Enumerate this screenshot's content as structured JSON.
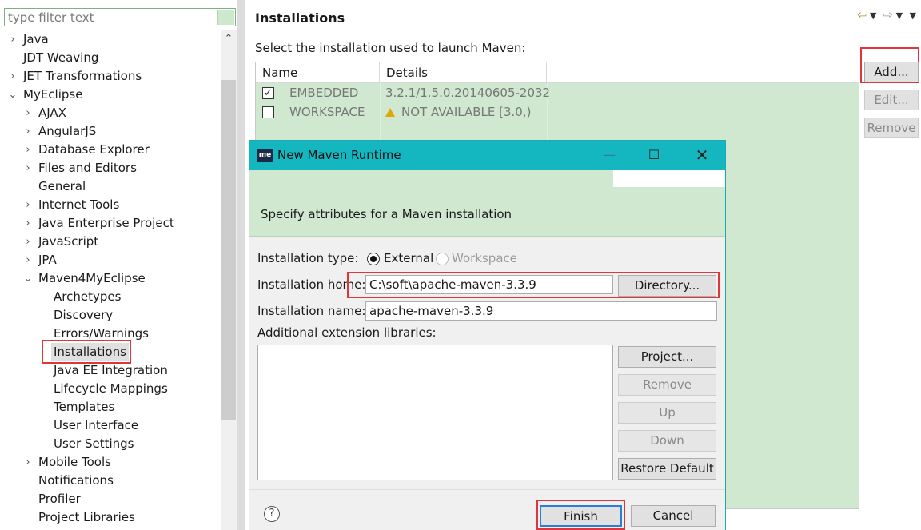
{
  "filter": {
    "placeholder": "type filter text"
  },
  "tree": [
    {
      "label": "Java",
      "chevron": "›"
    },
    {
      "label": "JDT Weaving",
      "chevron": ""
    },
    {
      "label": "JET Transformations",
      "chevron": "›"
    },
    {
      "label": "MyEclipse",
      "chevron": "⌄"
    },
    {
      "label": "AJAX",
      "chevron": "›"
    },
    {
      "label": "AngularJS",
      "chevron": "›"
    },
    {
      "label": "Database Explorer",
      "chevron": "›"
    },
    {
      "label": "Files and Editors",
      "chevron": "›"
    },
    {
      "label": "General",
      "chevron": ""
    },
    {
      "label": "Internet Tools",
      "chevron": "›"
    },
    {
      "label": "Java Enterprise Project",
      "chevron": "›"
    },
    {
      "label": "JavaScript",
      "chevron": "›"
    },
    {
      "label": "JPA",
      "chevron": "›"
    },
    {
      "label": "Maven4MyEclipse",
      "chevron": "⌄"
    },
    {
      "label": "Archetypes",
      "chevron": ""
    },
    {
      "label": "Discovery",
      "chevron": ""
    },
    {
      "label": "Errors/Warnings",
      "chevron": ""
    },
    {
      "label": "Installations",
      "chevron": ""
    },
    {
      "label": "Java EE Integration",
      "chevron": ""
    },
    {
      "label": "Lifecycle Mappings",
      "chevron": ""
    },
    {
      "label": "Templates",
      "chevron": ""
    },
    {
      "label": "User Interface",
      "chevron": ""
    },
    {
      "label": "User Settings",
      "chevron": ""
    },
    {
      "label": "Mobile Tools",
      "chevron": "›"
    },
    {
      "label": "Notifications",
      "chevron": ""
    },
    {
      "label": "Profiler",
      "chevron": ""
    },
    {
      "label": "Project Libraries",
      "chevron": ""
    }
  ],
  "page": {
    "title": "Installations",
    "select_label": "Select the installation used to launch Maven:",
    "columns": {
      "name": "Name",
      "details": "Details"
    },
    "rows": [
      {
        "checked": "✓",
        "name": "EMBEDDED",
        "details": "3.2.1/1.5.0.20140605-2032"
      },
      {
        "checked": "",
        "name": "WORKSPACE",
        "details": "NOT AVAILABLE [3.0,)"
      }
    ],
    "buttons": {
      "add": "Add...",
      "edit": "Edit...",
      "remove": "Remove"
    }
  },
  "icons": {
    "back": "back-arrow-icon",
    "forward": "forward-arrow-icon",
    "menu": "view-menu-icon",
    "warning": "warning-icon",
    "logo": "myeclipse-logo-icon",
    "help": "help-icon"
  },
  "dialog": {
    "logo_text": "me",
    "title": "New Maven Runtime",
    "banner_message": "Specify attributes for a Maven installation",
    "type_label": "Installation type:",
    "type_external": "External",
    "type_workspace": "Workspace",
    "home_label": "Installation home:",
    "home_value": "C:\\soft\\apache-maven-3.3.9",
    "directory_button": "Directory...",
    "name_label": "Installation name:",
    "name_value": "apache-maven-3.3.9",
    "ext_label": "Additional extension libraries:",
    "side_buttons": {
      "project": "Project...",
      "remove": "Remove",
      "up": "Up",
      "down": "Down",
      "restore": "Restore Default"
    },
    "finish": "Finish",
    "cancel": "Cancel",
    "help_glyph": "?"
  },
  "colors": {
    "highlight": "#e0353b",
    "titlebar": "#14b6c0",
    "table_bg": "#cfe8cf"
  }
}
